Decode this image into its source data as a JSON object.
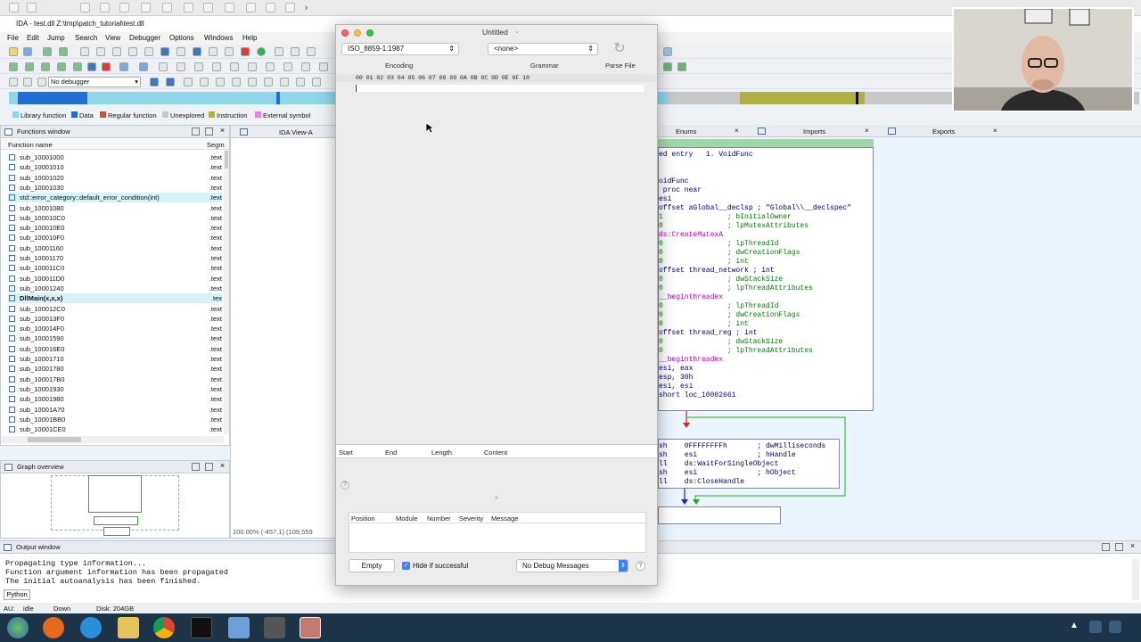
{
  "ida": {
    "window_title": "IDA - test.dll Z:\\tmp\\patch_tutorial\\test.dll",
    "menu": [
      "File",
      "Edit",
      "Jump",
      "Search",
      "View",
      "Debugger",
      "Options",
      "Windows",
      "Help"
    ],
    "debugger_select": "No debugger",
    "legend": [
      {
        "label": "Library function",
        "color": "#7fd8f2"
      },
      {
        "label": "Data",
        "color": "#1f6fd6"
      },
      {
        "label": "Regular function",
        "color": "#b85a3c"
      },
      {
        "label": "Unexplored",
        "color": "#c8c8c8"
      },
      {
        "label": "Instruction",
        "color": "#b0b040"
      },
      {
        "label": "External symbol",
        "color": "#f07ff0"
      }
    ],
    "functions_window": {
      "title": "Functions window",
      "col_name": "Function name",
      "col_seg": "Segm",
      "rows": [
        {
          "name": "sub_10001000",
          "seg": ".text"
        },
        {
          "name": "sub_10001010",
          "seg": ".text"
        },
        {
          "name": "sub_10001020",
          "seg": ".text"
        },
        {
          "name": "sub_10001030",
          "seg": ".text"
        },
        {
          "name": "std::error_category::default_error_condition(int)",
          "seg": ".text"
        },
        {
          "name": "sub_10001080",
          "seg": ".text"
        },
        {
          "name": "sub_100010C0",
          "seg": ".text"
        },
        {
          "name": "sub_100010E0",
          "seg": ".text"
        },
        {
          "name": "sub_100010F0",
          "seg": ".text"
        },
        {
          "name": "sub_10001160",
          "seg": ".text"
        },
        {
          "name": "sub_10001170",
          "seg": ".text"
        },
        {
          "name": "sub_100011C0",
          "seg": ".text"
        },
        {
          "name": "sub_100011D0",
          "seg": ".text"
        },
        {
          "name": "sub_10001240",
          "seg": ".text"
        },
        {
          "name": "DllMain(x,x,x)",
          "seg": ".tex"
        },
        {
          "name": "sub_100012C0",
          "seg": ".text"
        },
        {
          "name": "sub_100013F0",
          "seg": ".text"
        },
        {
          "name": "sub_100014F0",
          "seg": ".text"
        },
        {
          "name": "sub_10001590",
          "seg": ".text"
        },
        {
          "name": "sub_100016E0",
          "seg": ".text"
        },
        {
          "name": "sub_10001710",
          "seg": ".text"
        },
        {
          "name": "sub_10001780",
          "seg": ".text"
        },
        {
          "name": "sub_100017B0",
          "seg": ".text"
        },
        {
          "name": "sub_10001930",
          "seg": ".text"
        },
        {
          "name": "sub_10001980",
          "seg": ".text"
        },
        {
          "name": "sub_10001A70",
          "seg": ".text"
        },
        {
          "name": "sub_10001BB0",
          "seg": ".text"
        },
        {
          "name": "sub_10001CE0",
          "seg": ".text"
        }
      ]
    },
    "graph_overview_title": "Graph overview",
    "ida_view_title": "IDA View-A",
    "zoom_status": "100.00% (-457,1) (109,559",
    "tabs": {
      "enums": "Enums",
      "imports": "Imports",
      "exports": "Exports"
    },
    "asm_lines": [
      "ed entry   1. VoidFunc",
      "",
      "",
      "oidFunc",
      " proc near",
      "esi",
      "offset aGlobal__declsp ; \"Global\\\\__declspec\"",
      "1               ; bInitialOwner",
      "0               ; lpMutexAttributes",
      "ds:CreateMutexA",
      "0               ; lpThreadId",
      "0               ; dwCreationFlags",
      "0               ; int",
      "offset thread_network ; int",
      "0               ; dwStackSize",
      "0               ; lpThreadAttributes",
      "__beginthreadex",
      "0               ; lpThreadId",
      "0               ; dwCreationFlags",
      "0               ; int",
      "offset thread_reg ; int",
      "0               ; dwStackSize",
      "0               ; lpThreadAttributes",
      "__beginthreadex",
      "esi, eax",
      "esp, 30h",
      "esi, esi",
      "short loc_10002661"
    ],
    "asm_lines2": [
      "sh    0FFFFFFFFh       ; dwMilliseconds",
      "sh    esi              ; hHandle",
      "ll    ds:WaitForSingleObject",
      "sh    esi              ; hObject",
      "ll    ds:CloseHandle"
    ],
    "output_window": {
      "title": "Output window",
      "lines": [
        "Propagating type information...",
        "Function argument information has been propagated",
        "The initial autoanalysis has been finished."
      ],
      "python_button": "Python"
    },
    "status": {
      "au": "AU:",
      "state": "idle",
      "direction": "Down",
      "disk": "Disk: 204GB"
    }
  },
  "hexfiend": {
    "title": "Untitled",
    "encoding_value": "ISO_8859-1:1987",
    "encoding_label": "Encoding",
    "grammar_value": "<none>",
    "grammar_label": "Grammar",
    "parse_label": "Parse File",
    "hex_header": "00 01 02 03 04 05 06 07 08 09 0A 0B 0C 0D 0E 0F 10",
    "columns": [
      "Start",
      "End",
      "Length",
      "Content"
    ],
    "help_mark": "?",
    "debug_columns": [
      "Position",
      "Module",
      "Number",
      "Severity",
      "Message"
    ],
    "empty_button": "Empty",
    "hide_checkbox": "Hide if successful",
    "debug_select": "No Debug Messages"
  }
}
